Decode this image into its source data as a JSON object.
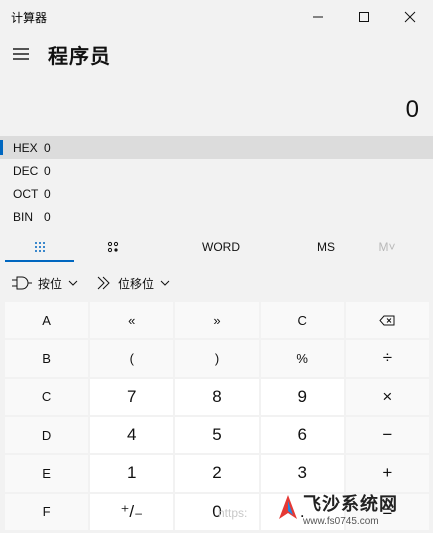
{
  "window": {
    "title": "计算器"
  },
  "header": {
    "mode": "程序员"
  },
  "display": {
    "value": "0"
  },
  "bases": [
    {
      "label": "HEX",
      "value": "0",
      "active": true
    },
    {
      "label": "DEC",
      "value": "0",
      "active": false
    },
    {
      "label": "OCT",
      "value": "0",
      "active": false
    },
    {
      "label": "BIN",
      "value": "0",
      "active": false
    }
  ],
  "tabs": {
    "full_keypad_icon": "keypad-grid-icon",
    "bit_toggle_icon": "bit-toggle-icon",
    "word": "WORD",
    "ms": "MS",
    "mplus": "M˅"
  },
  "bitops": {
    "bitwise": "按位",
    "bitshift": "位移位"
  },
  "keys": [
    [
      "A",
      "«",
      "»",
      "C",
      "⌫"
    ],
    [
      "B",
      "(",
      ")",
      "%",
      "÷"
    ],
    [
      "C",
      "7",
      "8",
      "9",
      "×"
    ],
    [
      "D",
      "4",
      "5",
      "6",
      "−"
    ],
    [
      "E",
      "1",
      "2",
      "3",
      "+"
    ],
    [
      "F",
      "⁺/₋",
      "0",
      ".",
      "="
    ]
  ],
  "watermark": {
    "title": "飞沙系统网",
    "url": "www.fs0745.com",
    "url_left": "https:"
  },
  "colors": {
    "accent": "#0067c0",
    "background": "#f2f2f2",
    "key_light": "#ffffff",
    "key_dim": "#f9f9f9"
  }
}
